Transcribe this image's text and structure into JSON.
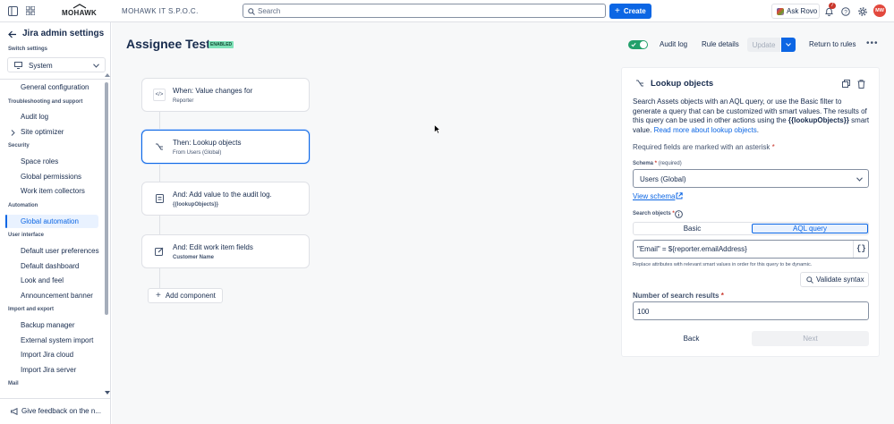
{
  "topbar": {
    "brand": "MOHAWK",
    "org": "MOHAWK IT S.P.O.C.",
    "search_placeholder": "Search",
    "create_label": "Create",
    "rovo_label": "Ask Rovo",
    "notif_count": "7",
    "avatar_initials": "MW"
  },
  "sidebar": {
    "title": "Jira admin settings",
    "switch_label": "Switch settings",
    "switch_value": "System",
    "items": {
      "general_config": "General configuration",
      "troubleshoot": "Troubleshooting and support",
      "audit_log": "Audit log",
      "site_optimizer": "Site optimizer",
      "security": "Security",
      "space_roles": "Space roles",
      "global_permissions": "Global permissions",
      "work_item_collectors": "Work item collectors",
      "automation": "Automation",
      "global_automation": "Global automation",
      "user_interface": "User interface",
      "default_user_prefs": "Default user preferences",
      "default_dashboard": "Default dashboard",
      "look_and_feel": "Look and feel",
      "announcement_banner": "Announcement banner",
      "import_export": "Import and export",
      "backup_manager": "Backup manager",
      "external_import": "External system import",
      "import_cloud": "Import Jira cloud",
      "import_server": "Import Jira server",
      "mail": "Mail"
    },
    "feedback": "Give feedback on the n..."
  },
  "rule": {
    "name": "Assignee Test",
    "status": "ENABLED",
    "audit_log": "Audit log",
    "rule_details": "Rule details",
    "update": "Update",
    "return": "Return to rules"
  },
  "flow": {
    "when_title": "When: Value changes for",
    "when_sub": "Reporter",
    "then_title": "Then: Lookup objects",
    "then_sub": "From Users (Global)",
    "and1_title": "And: Add value to the audit log.",
    "and1_sub": "{{lookupObjects}}",
    "and2_title": "And: Edit work item fields",
    "and2_sub": "Customer Name",
    "add_component": "Add component"
  },
  "panel": {
    "title": "Lookup objects",
    "desc_1": "Search Assets objects with an AQL query, or use the Basic filter to generate a query that can be customized with smart values. The results of this query can be used in other actions using the",
    "desc_code": "{{lookupObjects}}",
    "desc_2": "smart value.",
    "read_more": "Read more about lookup objects",
    "required_note": "Required fields are marked with an asterisk",
    "schema_label": "Schema",
    "schema_required": "(required)",
    "schema_value": "Users (Global)",
    "view_schema": "View schema",
    "search_objects_label": "Search objects",
    "tab_basic": "Basic",
    "tab_aql": "AQL query",
    "aql_value": "\"Email\" = ${reporter.emailAddress}",
    "aql_help": "Replace attributes with relevant smart values in order for this query to be dynamic.",
    "validate": "Validate syntax",
    "num_results_label": "Number of search results",
    "num_results_value": "100",
    "back": "Back",
    "next": "Next"
  },
  "colors": {
    "accent": "#0c66e4",
    "success": "#22a06b",
    "selected_bg": "#e9f2ff"
  }
}
